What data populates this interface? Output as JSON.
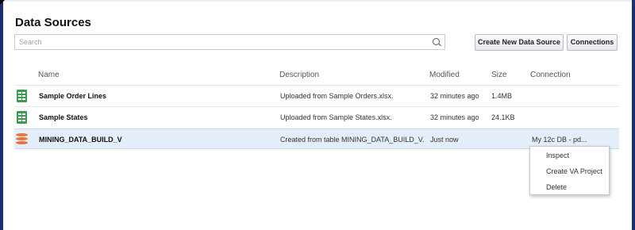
{
  "page": {
    "title": "Data Sources"
  },
  "search": {
    "placeholder": "Search"
  },
  "buttons": {
    "create_new": "Create New Data Source",
    "connections": "Connections"
  },
  "columns": [
    "Name",
    "Description",
    "Modified",
    "Size",
    "Connection"
  ],
  "rows": [
    {
      "icon": "spreadsheet-icon",
      "name": "Sample Order Lines",
      "description": "Uploaded from Sample Orders.xlsx.",
      "modified": "32 minutes ago",
      "size": "1.4MB",
      "connection": ""
    },
    {
      "icon": "spreadsheet-icon",
      "name": "Sample States",
      "description": "Uploaded from Sample States.xlsx.",
      "modified": "32 minutes ago",
      "size": "24.1KB",
      "connection": ""
    },
    {
      "icon": "database-icon",
      "name": "MINING_DATA_BUILD_V",
      "description": "Created from table MINING_DATA_BUILD_V.",
      "modified": "Just now",
      "size": "",
      "connection": "My 12c DB - pd..."
    }
  ],
  "context_menu": {
    "items": [
      "Inspect",
      "Create VA Project",
      "Delete"
    ]
  },
  "colors": {
    "selected_row": "#e4eefa",
    "frame": "#1c2f6e",
    "spreadsheet": "#3e9b4f",
    "database": "#e8743b"
  }
}
